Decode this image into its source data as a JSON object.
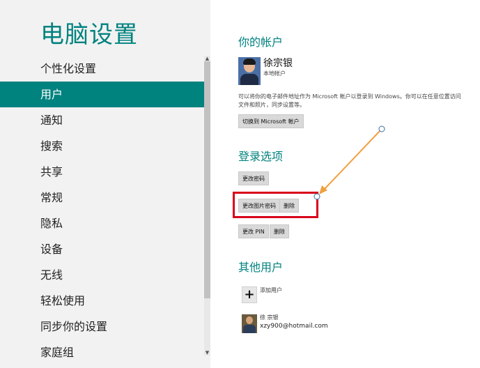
{
  "sidebar": {
    "title": "电脑设置",
    "items": [
      {
        "label": "个性化设置",
        "active": false
      },
      {
        "label": "用户",
        "active": true
      },
      {
        "label": "通知",
        "active": false
      },
      {
        "label": "搜索",
        "active": false
      },
      {
        "label": "共享",
        "active": false
      },
      {
        "label": "常规",
        "active": false
      },
      {
        "label": "隐私",
        "active": false
      },
      {
        "label": "设备",
        "active": false
      },
      {
        "label": "无线",
        "active": false
      },
      {
        "label": "轻松使用",
        "active": false
      },
      {
        "label": "同步你的设置",
        "active": false
      },
      {
        "label": "家庭组",
        "active": false
      }
    ]
  },
  "account": {
    "section_title": "你的帐户",
    "user_name": "徐宗银",
    "user_type": "本地帐户",
    "description": "可以将你的电子邮件地址作为 Microsoft 帐户以登录到 Windows。你可以在任意位置访问文件和照片，同步设置等。",
    "switch_button": "切换到 Microsoft 帐户"
  },
  "signin": {
    "section_title": "登录选项",
    "change_password": "更改密码",
    "change_picture_password": "更改图片密码",
    "delete_picture_password": "删除",
    "change_pin": "更改 PIN",
    "delete_pin": "删除"
  },
  "other_users": {
    "section_title": "其他用户",
    "add_user_label": "添加用户",
    "add_user_icon": "plus-icon",
    "users": [
      {
        "name": "徐 宗银",
        "email": "xzy900@hotmail.com"
      }
    ]
  },
  "colors": {
    "accent": "#00827f",
    "highlight_box": "#d9001b",
    "annotation_arrow": "#f0a040"
  }
}
